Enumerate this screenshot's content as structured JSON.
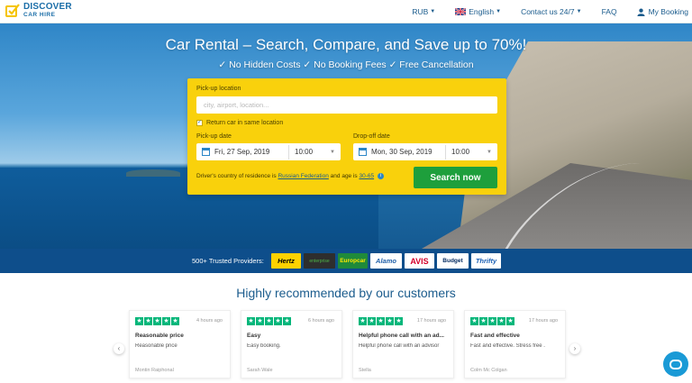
{
  "nav": {
    "logo_line1": "DISCOVER",
    "logo_line2": "CAR HIRE",
    "currency": "RUB",
    "language": "English",
    "contact": "Contact us 24/7",
    "faq": "FAQ",
    "account": "My Booking"
  },
  "hero": {
    "title": "Car Rental – Search, Compare, and Save up to 70%!",
    "subtitle": "✓ No Hidden Costs ✓ No Booking Fees ✓ Free Cancellation"
  },
  "form": {
    "pickup_label": "Pick-up location",
    "pickup_placeholder": "city, airport, location...",
    "return_same": "Return car in same location",
    "pickup_date_label": "Pick-up date",
    "pickup_date": "Fri, 27 Sep, 2019",
    "pickup_time": "10:00",
    "dropoff_date_label": "Drop-off date",
    "dropoff_date": "Mon, 30 Sep, 2019",
    "dropoff_time": "10:00",
    "residence_prefix": "Driver's country of residence is",
    "country": "Russian Federation",
    "age_prefix": "and age is",
    "age": "30-65",
    "search_button": "Search now"
  },
  "providers": {
    "label": "500+ Trusted Providers:",
    "items": [
      "Hertz",
      "enterprise",
      "Europcar",
      "Alamo",
      "AVIS",
      "Budget",
      "Thrifty"
    ]
  },
  "reviews": {
    "title": "Highly recommended by our customers",
    "cards": [
      {
        "ago": "4 hours ago",
        "title": "Reasonable price",
        "body": "Reasonable price",
        "author": "Montin Raiphonal"
      },
      {
        "ago": "6 hours ago",
        "title": "Easy",
        "body": "Easy booking.",
        "author": "Sarah Wale"
      },
      {
        "ago": "17 hours ago",
        "title": "Helpful phone call with an ad...",
        "body": "Helpful phone call with an advisor",
        "author": "Stella"
      },
      {
        "ago": "17 hours ago",
        "title": "Fast and effective",
        "body": "Fast and effective. Stress free .",
        "author": "Colm Mc Colgan"
      }
    ]
  },
  "colors": {
    "brand_blue": "#1b5c8d",
    "form_yellow": "#f9d10c",
    "search_green": "#1e9f3c",
    "trustpilot_green": "#00b67a"
  }
}
